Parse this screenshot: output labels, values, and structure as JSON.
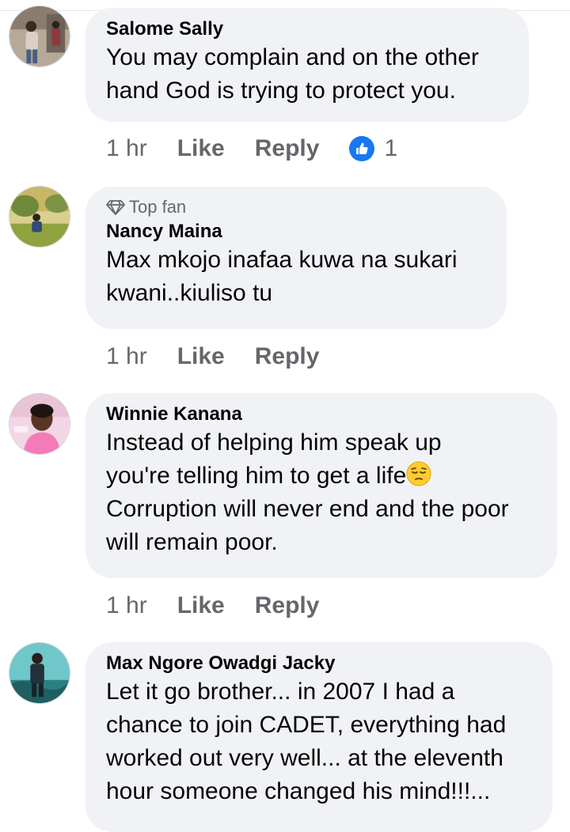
{
  "comments": [
    {
      "name": "Salome Sally",
      "text_lines": [
        "You may complain and on the other",
        "hand God is trying to protect you."
      ],
      "time": "1 hr",
      "like_label": "Like",
      "reply_label": "Reply",
      "reaction": {
        "icon": "thumbs-up-icon",
        "count": "1",
        "color": "#1877f2"
      }
    },
    {
      "badge": "Top fan",
      "badge_icon": "diamond-icon",
      "name": "Nancy Maina",
      "text_lines": [
        "Max mkojo inafaa kuwa na sukari",
        "kwani..kiuliso tu"
      ],
      "time": "1 hr",
      "like_label": "Like",
      "reply_label": "Reply"
    },
    {
      "name": "Winnie Kanana",
      "text_lines": [
        "Instead of helping him speak up",
        "you're telling him to get a life",
        "Corruption will never end and the poor",
        "will remain poor."
      ],
      "emoji": "pensive-face-icon",
      "time": "1 hr",
      "like_label": "Like",
      "reply_label": "Reply"
    },
    {
      "name": "Max Ngore Owadgi Jacky",
      "text_lines": [
        "Let it go brother... in 2007 I had a",
        "chance to join CADET, everything had",
        "worked out very well... at the eleventh",
        "hour someone changed his mind!!!..."
      ]
    }
  ],
  "colors": {
    "bubble": "#f0f2f5",
    "meta": "#65676b",
    "accent": "#1877f2"
  }
}
